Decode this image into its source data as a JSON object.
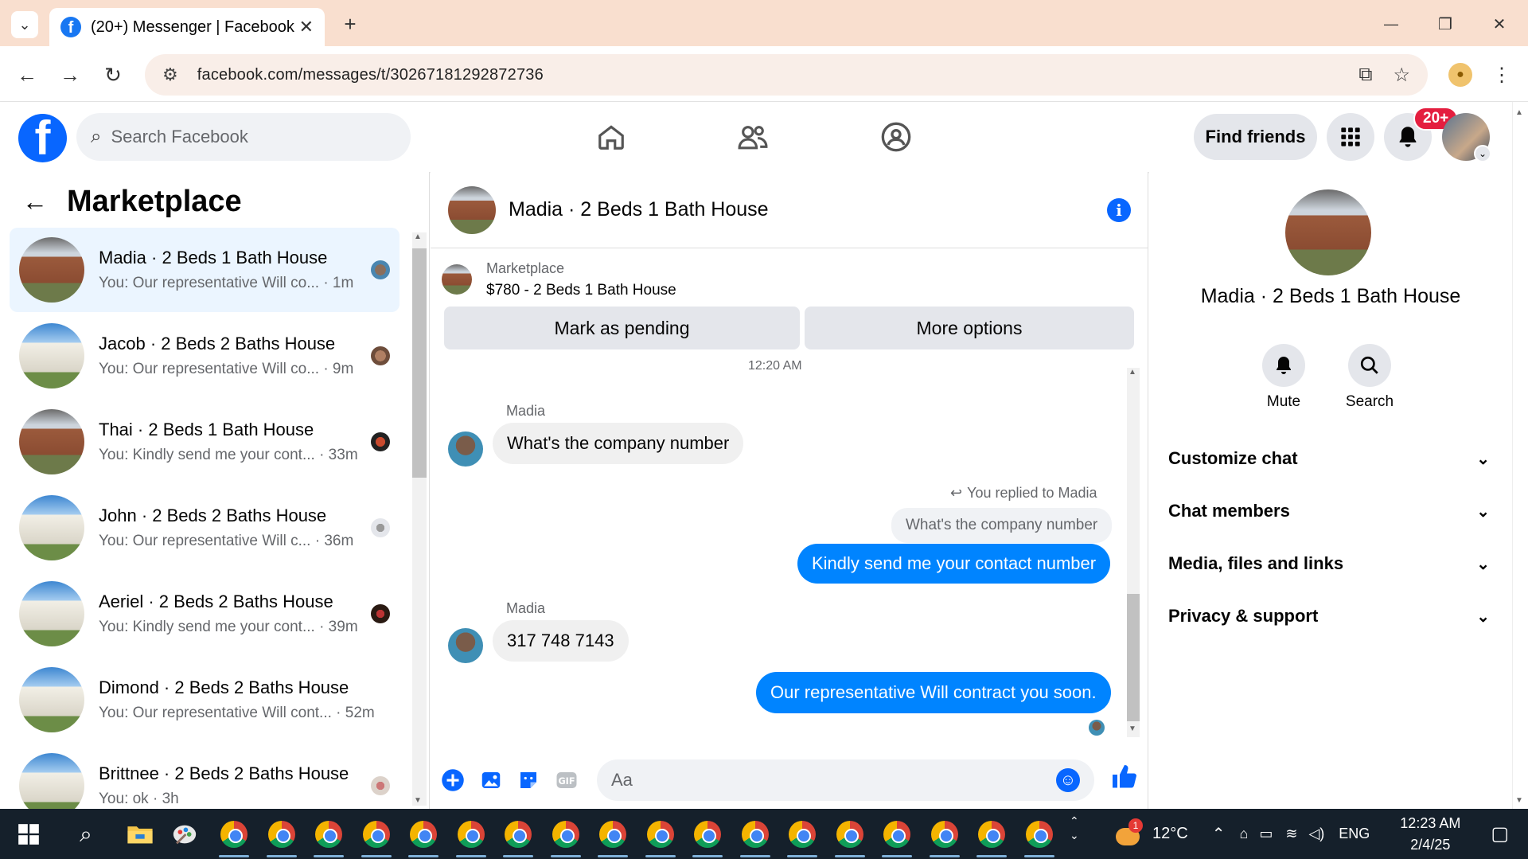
{
  "browser": {
    "tab_title": "(20+) Messenger | Facebook",
    "url": "facebook.com/messages/t/30267181292872736",
    "new_tab": "+",
    "win_min": "—",
    "win_restore": "❐",
    "win_close": "✕"
  },
  "fb": {
    "search_placeholder": "Search Facebook",
    "find_friends": "Find friends",
    "notif_badge": "20+",
    "brand_color": "#0866ff"
  },
  "left": {
    "title": "Marketplace",
    "conversations": [
      {
        "name": "Madia · 2 Beds 1 Bath House",
        "preview": "You: Our representative Will co...",
        "time": "· 1m",
        "thumb": "madia"
      },
      {
        "name": "Jacob · 2 Beds 2 Baths House",
        "preview": "You: Our representative Will co...",
        "time": "· 9m",
        "thumb": "house"
      },
      {
        "name": "Thai · 2 Beds 1 Bath House",
        "preview": "You: Kindly send me your cont...",
        "time": "· 33m",
        "thumb": "madia"
      },
      {
        "name": "John · 2 Beds 2 Baths House",
        "preview": "You: Our representative Will c...",
        "time": "· 36m",
        "thumb": "house"
      },
      {
        "name": "Aeriel · 2 Beds 2 Baths House",
        "preview": "You: Kindly send me your cont...",
        "time": "· 39m",
        "thumb": "house"
      },
      {
        "name": "Dimond · 2 Beds 2 Baths House",
        "preview": "You: Our representative Will cont...",
        "time": "· 52m",
        "thumb": "house"
      },
      {
        "name": "Brittnee · 2 Beds 2 Baths House",
        "preview": "You: ok",
        "time": "· 3h",
        "thumb": "house"
      }
    ]
  },
  "chat": {
    "title": "Madia · 2 Beds 1 Bath House",
    "marketplace_label": "Marketplace",
    "listing": "$780 - 2 Beds 1 Bath House",
    "mark_pending": "Mark as pending",
    "more_options": "More options",
    "time_sep": "12:20 AM",
    "messages": {
      "m1_sender": "Madia",
      "m1_text": "What's the company number",
      "reply_note": "You replied to Madia",
      "quoted": "What's the company number",
      "m2_text": "Kindly send me your contact number",
      "m3_sender": "Madia",
      "m3_text": "317 748 7143",
      "m4_text": "Our representative Will contract you soon."
    },
    "input_placeholder": "Aa"
  },
  "right": {
    "name": "Madia · 2 Beds 1 Bath House",
    "mute": "Mute",
    "search": "Search",
    "sections": [
      "Customize chat",
      "Chat members",
      "Media, files and links",
      "Privacy & support"
    ]
  },
  "taskbar": {
    "temp": "12°C",
    "lang": "ENG",
    "time": "12:23 AM",
    "date": "2/4/25",
    "weather_badge": "1"
  }
}
